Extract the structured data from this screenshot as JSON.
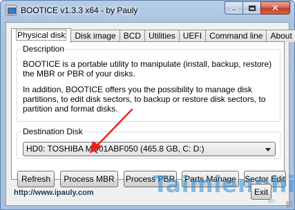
{
  "window": {
    "title": "BOOTICE v1.3.3 x64 - by Pauly",
    "minimize_glyph": "",
    "maximize_glyph": "",
    "close_glyph": "✕"
  },
  "tabs": [
    {
      "label": "Physical disk",
      "active": true
    },
    {
      "label": "Disk image",
      "active": false
    },
    {
      "label": "BCD",
      "active": false
    },
    {
      "label": "Utilities",
      "active": false
    },
    {
      "label": "UEFI",
      "active": false
    },
    {
      "label": "Command line",
      "active": false
    },
    {
      "label": "About",
      "active": false
    }
  ],
  "description": {
    "title": "Description",
    "paragraph1": "BOOTICE is a portable utility to manipulate (install, backup, restore) the MBR or PBR of your disks.",
    "paragraph2": "In addition, BOOTICE offers you the possibility to manage disk partitions, to edit disk sectors, to backup or restore disk sectors, to partition and format disks."
  },
  "destination": {
    "title": "Destination Disk",
    "selected": "HD0: TOSHIBA MQ01ABF050 (465.8 GB, C: D:)"
  },
  "buttons": {
    "refresh": "Refresh",
    "process_mbr": "Process MBR",
    "process_pbr": "Process PBR",
    "parts_manage": "Parts Manage",
    "sector_edit": "Sector Edit"
  },
  "footer": {
    "website": "http://www.ipauly.com",
    "exit": "Exit"
  },
  "watermark": {
    "brand": "Taimienphi",
    "sub": ".vn"
  },
  "colors": {
    "annotation_arrow": "#e8231d",
    "watermark": "#2f8ed6"
  }
}
